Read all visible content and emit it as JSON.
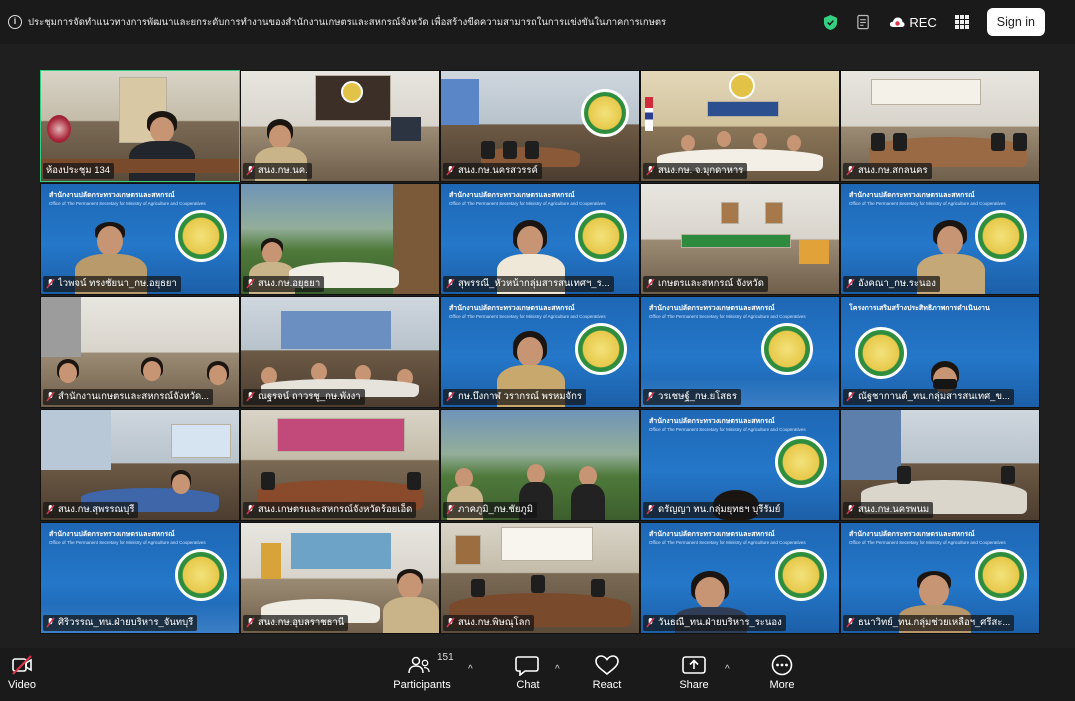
{
  "meeting": {
    "title": "ประชุมการจัดทำแนวทางการพัฒนาและยกระดับการทำงานของสำนักงานเกษตรและสหกรณ์จังหวัด เพื่อสร้างขีดความสามารถในการแข่งขันในภาคการเกษตร"
  },
  "topbar": {
    "rec_label": "REC",
    "signin_label": "Sign in"
  },
  "banner": {
    "ops_main": "สำนักงานปลัดกระทรวงเกษตรและสหกรณ์",
    "ops_sub": "Office of The Permanent Secretary for Ministry of Agriculture and Cooperatives",
    "project": "โครงการเสริมสร้างประสิทธิภาพการดำเนินงาน"
  },
  "tiles": [
    {
      "name": "ห้องประชุม 134",
      "active": true
    },
    {
      "name": "สนง.กษ.นค."
    },
    {
      "name": "สนง.กษ.นครสวรรค์"
    },
    {
      "name": "สนง.กษ. จ.มุกดาหาร"
    },
    {
      "name": "สนง.กษ.สกลนคร"
    },
    {
      "name": "ไวพจน์ ทรงชัยนา_กษ.อยุธยา"
    },
    {
      "name": "สนง.กษ.อยุธยา"
    },
    {
      "name": "สุพรรณี_หัวหน้ากลุ่มสารสนเทศฯ_ร..."
    },
    {
      "name": "เกษตรและสหกรณ์ จังหวัด"
    },
    {
      "name": "อังคณา_กษ.ระนอง"
    },
    {
      "name": "สำนักงานเกษตรและสหกรณ์จังหวัด..."
    },
    {
      "name": "ณฐรจน์ ถาวรชู_กษ.พังงา"
    },
    {
      "name": "กษ.บึงกาฬ วรากรณ์ พรหมจักร"
    },
    {
      "name": "วรเชษฐ์_กษ.ยโสธร"
    },
    {
      "name": "ณัฐชากานต์_ทน.กลุ่มสารสนเทศ_ข..."
    },
    {
      "name": "สนง.กษ.สุพรรณบุรี"
    },
    {
      "name": "สนง.เกษตรและสหกรณ์จังหวัดร้อยเอ็ด"
    },
    {
      "name": "ภาคภูมิ_กษ.ชัยภูมิ"
    },
    {
      "name": "ดรัญญา ทน.กลุ่มยุทธฯ บุรีรัมย์"
    },
    {
      "name": "สนง.กษ.นครพนม"
    },
    {
      "name": "ศิริวรรณ_ทน.ฝ่ายบริหาร_จันทบุรี"
    },
    {
      "name": "สนง.กษ.อุบลราชธานี"
    },
    {
      "name": "สนง.กษ.พิษณุโลก"
    },
    {
      "name": "วันธณี_ทน.ฝ่ายบริหาร_ระนอง"
    },
    {
      "name": "ธนาวิทย์_ทน.กลุ่มช่วยเหลือฯ_ศรีสะ..."
    }
  ],
  "toolbar": {
    "video_label": "Video",
    "participants_label": "Participants",
    "participants_count": "151",
    "chat_label": "Chat",
    "react_label": "React",
    "share_label": "Share",
    "more_label": "More"
  },
  "colors": {
    "active_speaker": "#35d07f",
    "muted_mic": "#e0334a",
    "video_off": "#e0334a",
    "shield": "#35d07f"
  },
  "icons": [
    "info-icon",
    "shield-icon",
    "notes-icon",
    "record-cloud-icon",
    "apps-grid-icon",
    "video-off-icon",
    "participants-icon",
    "chat-icon",
    "react-icon",
    "share-icon",
    "more-icon",
    "muted-mic-icon"
  ]
}
